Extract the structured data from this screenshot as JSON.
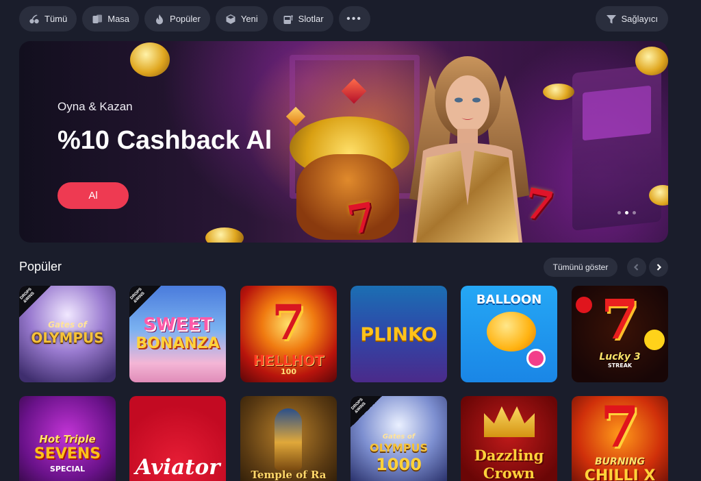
{
  "topbar": {
    "filters": [
      {
        "label": "Tümü",
        "icon": "cherry-icon"
      },
      {
        "label": "Masa",
        "icon": "cards-icon"
      },
      {
        "label": "Popüler",
        "icon": "flame-icon"
      },
      {
        "label": "Yeni",
        "icon": "cube-icon"
      },
      {
        "label": "Slotlar",
        "icon": "slot-machine-icon"
      }
    ],
    "more_label": "•••",
    "provider_label": "Sağlayıcı"
  },
  "hero": {
    "subtitle": "Oyna & Kazan",
    "title": "%10 Cashback Al",
    "button_label": "Al",
    "slide_count": 3,
    "active_slide": 2
  },
  "popular": {
    "title": "Popüler",
    "show_all_label": "Tümünü göster"
  },
  "games": {
    "row1": [
      {
        "name": "Gates of Olympus",
        "badge": "DROPS & WINS"
      },
      {
        "name": "Sweet Bonanza",
        "badge": "DROPS & WINS"
      },
      {
        "name": "Hell Hot 100"
      },
      {
        "name": "PLINKO"
      },
      {
        "name": "BALLOON"
      },
      {
        "name": "Lucky Streak 3"
      }
    ],
    "row2": [
      {
        "name": "Hot Triple Sevens Special"
      },
      {
        "name": "Aviator"
      },
      {
        "name": "Temple of Ra"
      },
      {
        "name": "Gates of Olympus 1000",
        "badge": "DROPS & WINS"
      },
      {
        "name": "Dazzling Crown"
      },
      {
        "name": "Burning Chilli X"
      }
    ],
    "tile_text": {
      "gates_line1": "Gates of",
      "gates_line2": "OLYMPUS",
      "sweet_line1": "SWEET",
      "sweet_line2": "BONANZA",
      "hellhot_line1": "HELLHOT",
      "hellhot_line2": "100",
      "plinko": "PLINKO",
      "balloon": "BALLOON",
      "lucky_line1": "Lucky",
      "lucky_line2": "3",
      "lucky_line3": "STREAK",
      "triple_line1": "Hot Triple",
      "triple_line2": "SEVENS",
      "triple_line3": "SPECIAL",
      "aviator": "Aviator",
      "temple": "Temple of Ra",
      "g1000_line1": "Gates of",
      "g1000_line2": "OLYMPUS",
      "g1000_line3": "1000",
      "dazzling_line1": "Dazzling",
      "dazzling_line2": "Crown",
      "chilli_line1": "BURNING",
      "chilli_line2": "CHILLI X"
    },
    "badge_text": "DROPS\n&WINS"
  },
  "colors": {
    "page_bg": "#1a1d2b",
    "chip_bg": "#2a2e3d",
    "cta": "#ee3a52"
  }
}
